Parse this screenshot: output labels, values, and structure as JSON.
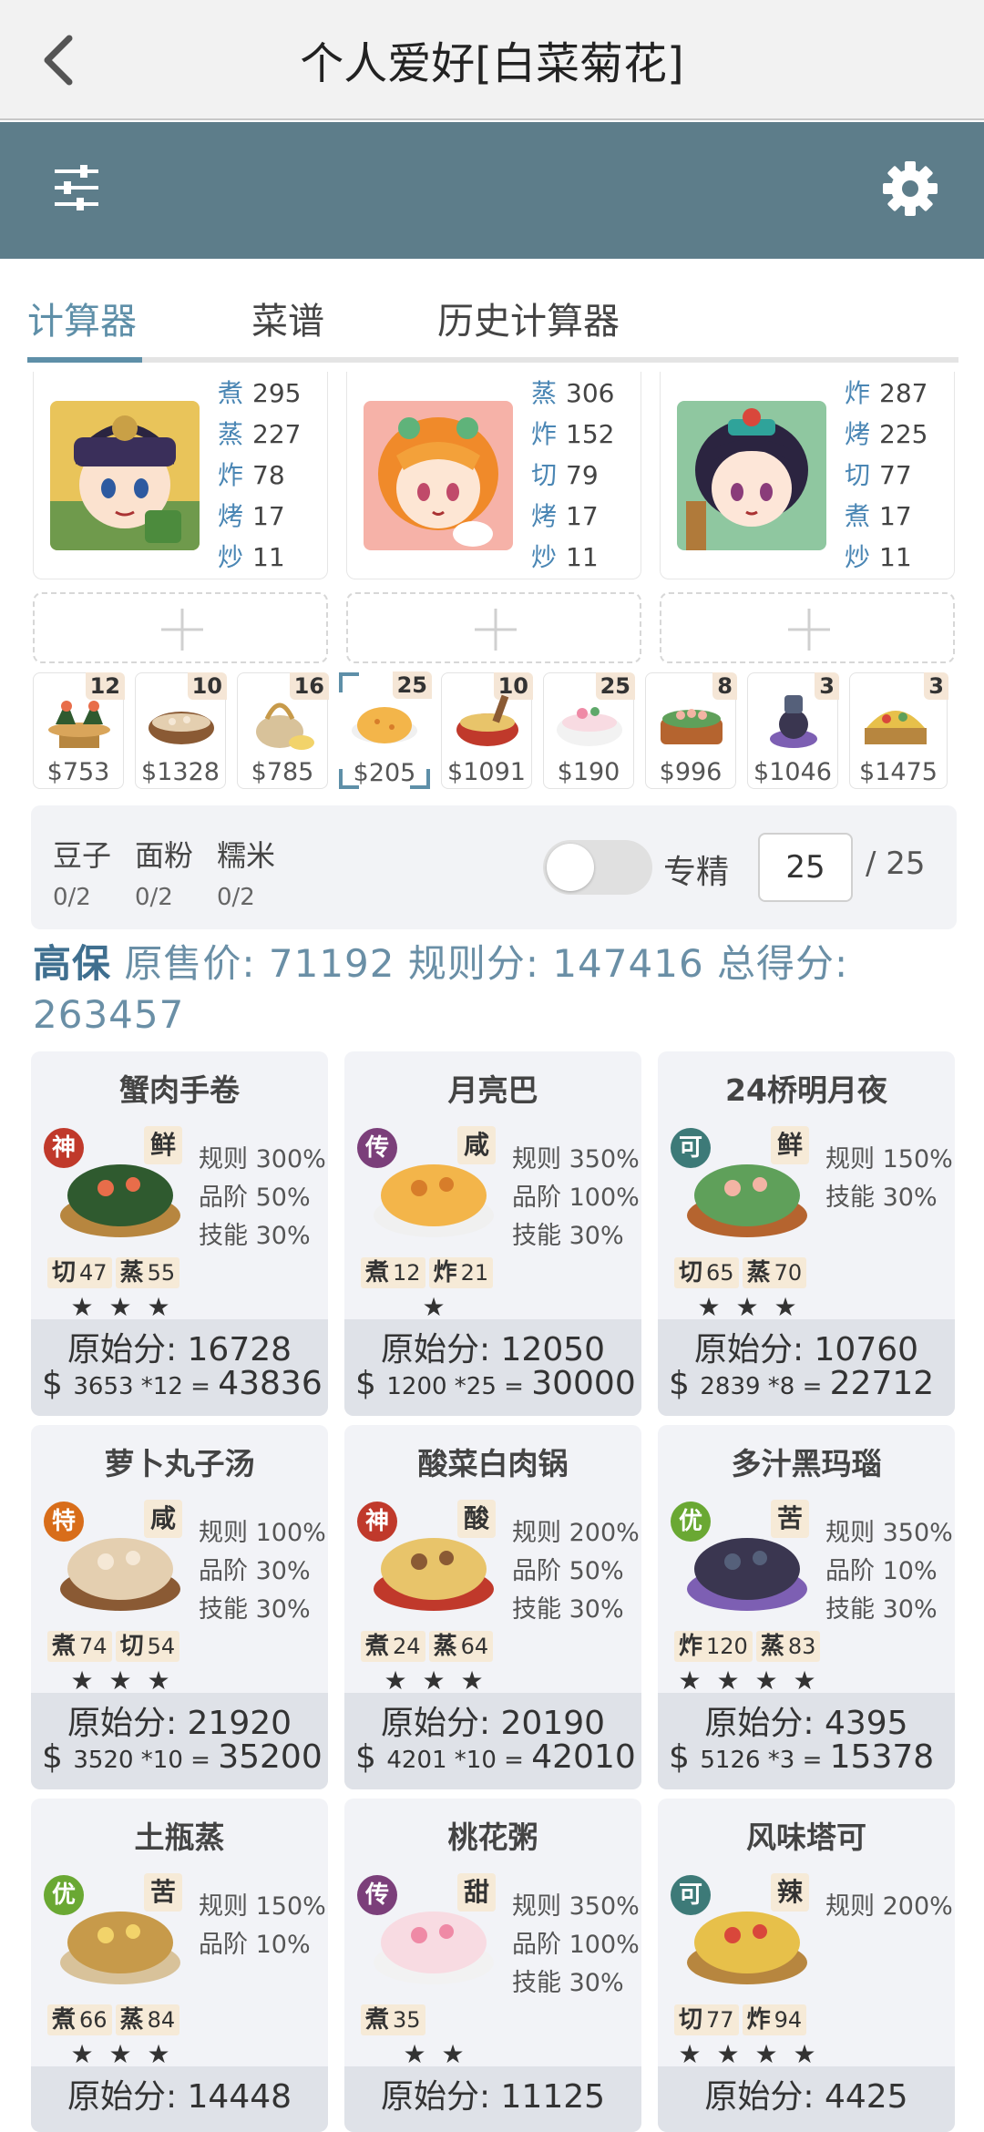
{
  "header": {
    "title": "个人爱好[白菜菊花]"
  },
  "tabs": [
    {
      "label": "计算器",
      "active": true
    },
    {
      "label": "菜谱",
      "active": false
    },
    {
      "label": "历史计算器",
      "active": false
    }
  ],
  "chefs": [
    {
      "stats": [
        {
          "k": "煮",
          "v": "295"
        },
        {
          "k": "蒸",
          "v": "227"
        },
        {
          "k": "炸",
          "v": "78"
        },
        {
          "k": "烤",
          "v": "17"
        },
        {
          "k": "炒",
          "v": "11"
        }
      ]
    },
    {
      "stats": [
        {
          "k": "蒸",
          "v": "306"
        },
        {
          "k": "炸",
          "v": "152"
        },
        {
          "k": "切",
          "v": "79"
        },
        {
          "k": "烤",
          "v": "17"
        },
        {
          "k": "炒",
          "v": "11"
        }
      ]
    },
    {
      "stats": [
        {
          "k": "炸",
          "v": "287"
        },
        {
          "k": "烤",
          "v": "225"
        },
        {
          "k": "切",
          "v": "77"
        },
        {
          "k": "煮",
          "v": "17"
        },
        {
          "k": "炒",
          "v": "11"
        }
      ]
    }
  ],
  "ingredients": [
    {
      "count": "12",
      "price": "$753"
    },
    {
      "count": "10",
      "price": "$1328"
    },
    {
      "count": "16",
      "price": "$785"
    },
    {
      "count": "25",
      "price": "$205",
      "selected": true
    },
    {
      "count": "10",
      "price": "$1091"
    },
    {
      "count": "25",
      "price": "$190"
    },
    {
      "count": "8",
      "price": "$996"
    },
    {
      "count": "3",
      "price": "$1046"
    },
    {
      "count": "3",
      "price": "$1475"
    }
  ],
  "materials": [
    {
      "name": "豆子",
      "value": "0/2"
    },
    {
      "name": "面粉",
      "value": "0/2"
    },
    {
      "name": "糯米",
      "value": "0/2"
    }
  ],
  "specialty": {
    "label": "专精",
    "value": "25",
    "total": "/ 25",
    "enabled": false
  },
  "summary": {
    "label": "高保",
    "text": "原售价:  71192  规则分:  147416  总得分:  263457"
  },
  "dishes": [
    {
      "name": "蟹肉手卷",
      "grade": "神",
      "grade_color": "#c0392b",
      "taste": "鲜",
      "rules": [
        "规则 300%",
        "品阶 50%",
        "技能 30%"
      ],
      "skills": [
        {
          "k": "切",
          "v": "47"
        },
        {
          "k": "蒸",
          "v": "55"
        }
      ],
      "stars": "★ ★ ★",
      "orig": "原始分: 16728",
      "cur": "$",
      "price": "3653 *12",
      "eq": "=",
      "total": "43836"
    },
    {
      "name": "月亮巴",
      "grade": "传",
      "grade_color": "#7b3f7a",
      "taste": "咸",
      "rules": [
        "规则 350%",
        "品阶 100%",
        "技能 30%"
      ],
      "skills": [
        {
          "k": "煮",
          "v": "12"
        },
        {
          "k": "炸",
          "v": "21"
        }
      ],
      "stars": "★",
      "orig": "原始分: 12050",
      "cur": "$",
      "price": "1200 *25",
      "eq": "=",
      "total": "30000"
    },
    {
      "name": "24桥明月夜",
      "grade": "可",
      "grade_color": "#3d7a78",
      "taste": "鲜",
      "rules": [
        "规则 150%",
        "技能 30%"
      ],
      "skills": [
        {
          "k": "切",
          "v": "65"
        },
        {
          "k": "蒸",
          "v": "70"
        }
      ],
      "stars": "★ ★ ★",
      "orig": "原始分: 10760",
      "cur": "$",
      "price": "2839 *8",
      "eq": "=",
      "total": "22712"
    },
    {
      "name": "萝卜丸子汤",
      "grade": "特",
      "grade_color": "#d86d1a",
      "taste": "咸",
      "rules": [
        "规则 100%",
        "品阶 30%",
        "技能 30%"
      ],
      "skills": [
        {
          "k": "煮",
          "v": "74"
        },
        {
          "k": "切",
          "v": "54"
        }
      ],
      "stars": "★ ★ ★",
      "orig": "原始分: 21920",
      "cur": "$",
      "price": "3520 *10",
      "eq": "=",
      "total": "35200"
    },
    {
      "name": "酸菜白肉锅",
      "grade": "神",
      "grade_color": "#c0392b",
      "taste": "酸",
      "rules": [
        "规则 200%",
        "品阶 50%",
        "技能 30%"
      ],
      "skills": [
        {
          "k": "煮",
          "v": "24"
        },
        {
          "k": "蒸",
          "v": "64"
        }
      ],
      "stars": "★ ★ ★",
      "orig": "原始分: 20190",
      "cur": "$",
      "price": "4201 *10",
      "eq": "=",
      "total": "42010"
    },
    {
      "name": "多汁黑玛瑙",
      "grade": "优",
      "grade_color": "#6aa833",
      "taste": "苦",
      "rules": [
        "规则 350%",
        "品阶 10%",
        "技能 30%"
      ],
      "skills": [
        {
          "k": "炸",
          "v": "120"
        },
        {
          "k": "蒸",
          "v": "83"
        }
      ],
      "stars": "★ ★ ★ ★",
      "orig": "原始分: 4395",
      "cur": "$",
      "price": "5126 *3",
      "eq": "=",
      "total": "15378"
    },
    {
      "name": "土瓶蒸",
      "grade": "优",
      "grade_color": "#6aa833",
      "taste": "苦",
      "rules": [
        "规则 150%",
        "品阶 10%"
      ],
      "skills": [
        {
          "k": "煮",
          "v": "66"
        },
        {
          "k": "蒸",
          "v": "84"
        }
      ],
      "stars": "★ ★ ★",
      "orig": "原始分: 14448"
    },
    {
      "name": "桃花粥",
      "grade": "传",
      "grade_color": "#7b3f7a",
      "taste": "甜",
      "rules": [
        "规则 350%",
        "品阶 100%",
        "技能 30%"
      ],
      "skills": [
        {
          "k": "煮",
          "v": "35"
        }
      ],
      "stars": "★ ★",
      "orig": "原始分: 11125"
    },
    {
      "name": "风味塔可",
      "grade": "可",
      "grade_color": "#3d7a78",
      "taste": "辣",
      "rules": [
        "规则 200%"
      ],
      "skills": [
        {
          "k": "切",
          "v": "77"
        },
        {
          "k": "炸",
          "v": "94"
        }
      ],
      "stars": "★ ★ ★ ★",
      "orig": "原始分: 4425"
    }
  ]
}
